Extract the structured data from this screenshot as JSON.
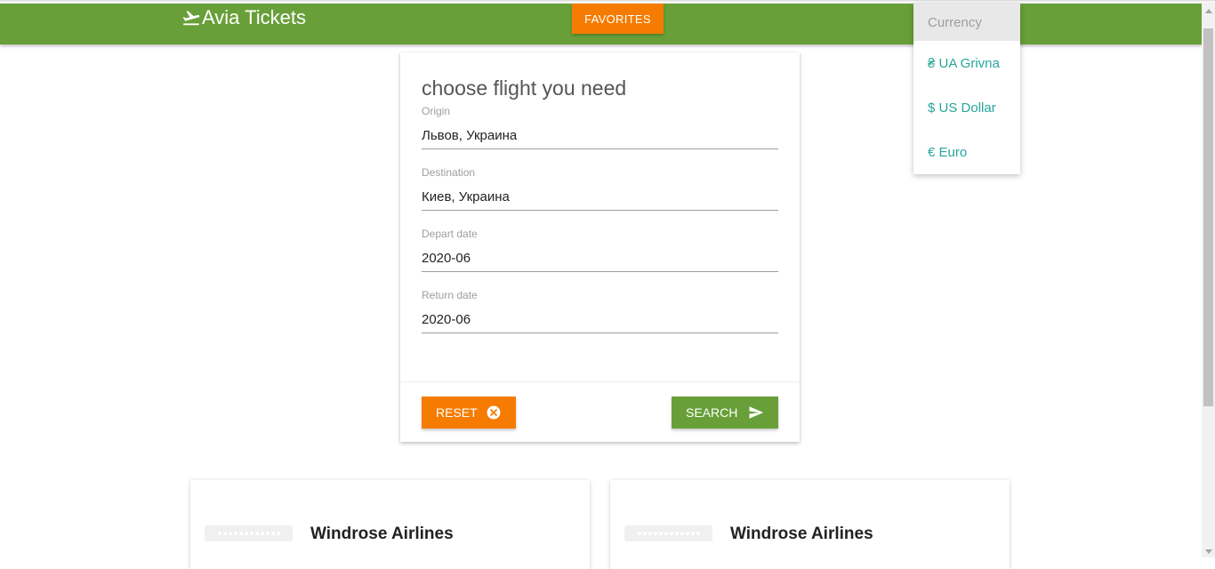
{
  "header": {
    "brand": "Avia Tickets",
    "favorites_label": "FAVORITES",
    "nav_color": "#689f38",
    "accent_color": "#f57c00"
  },
  "currency_menu": {
    "heading": "Currency",
    "items": [
      "₴ UA Grivna",
      "$ US Dollar",
      "€ Euro"
    ]
  },
  "form": {
    "title": "choose flight you need",
    "fields": [
      {
        "label": "Origin",
        "value": "Львов, Украина"
      },
      {
        "label": "Destination",
        "value": "Киев, Украина"
      },
      {
        "label": "Depart date",
        "value": "2020-06"
      },
      {
        "label": "Return date",
        "value": "2020-06"
      }
    ],
    "reset_label": "RESET",
    "search_label": "SEARCH"
  },
  "tickets": [
    {
      "airline": "Windrose Airlines"
    },
    {
      "airline": "Windrose Airlines"
    }
  ]
}
